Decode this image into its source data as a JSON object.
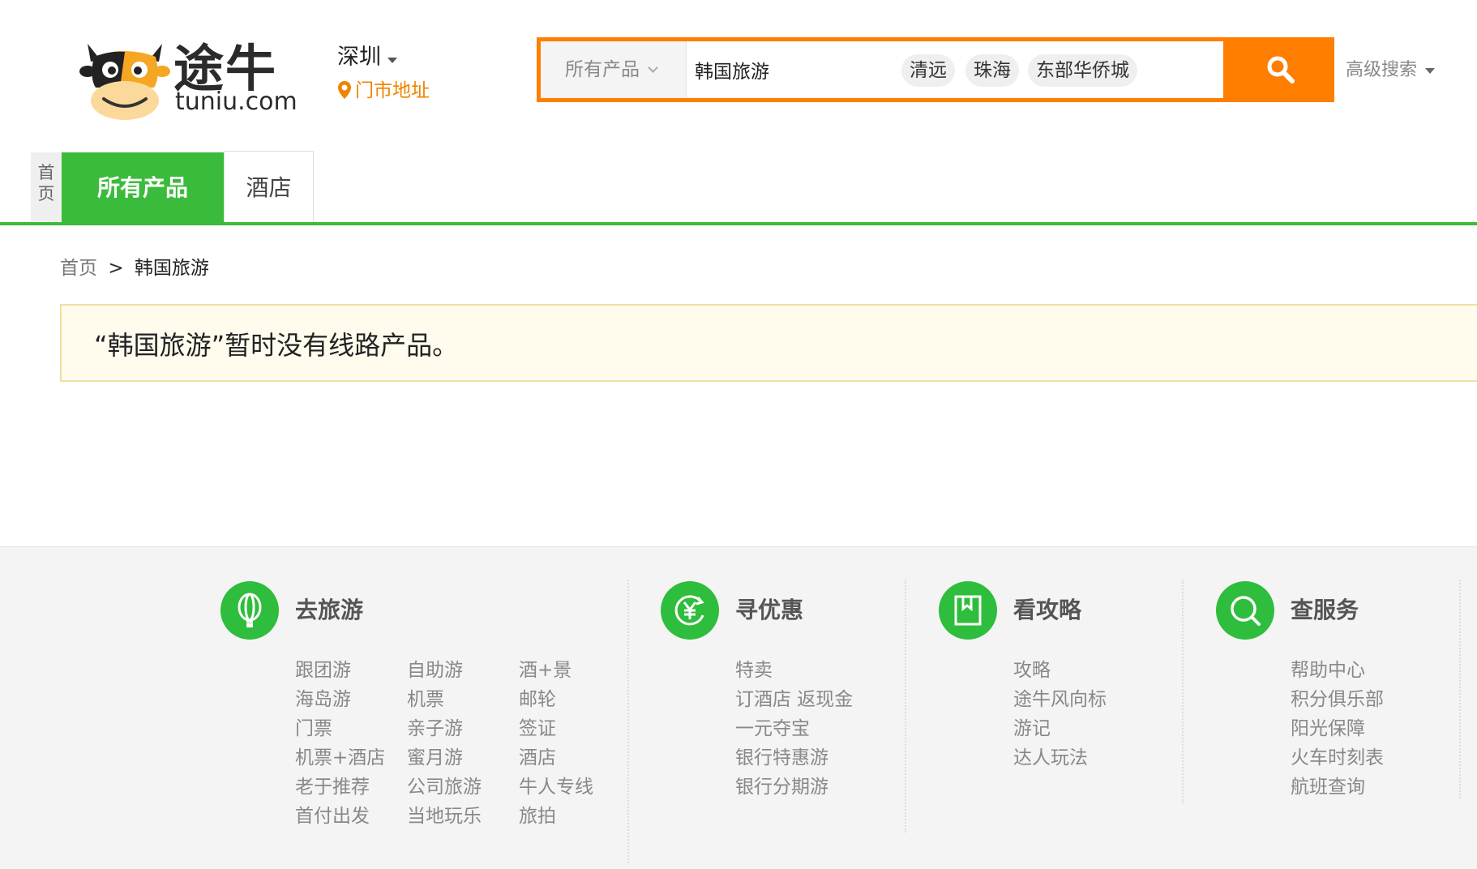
{
  "header": {
    "logo_cn": "途牛",
    "logo_en": "tuniu.com",
    "city": "深圳",
    "store_link": "门市地址",
    "search": {
      "category": "所有产品",
      "query": "韩国旅游",
      "tags": [
        "清远",
        "珠海",
        "东部华侨城"
      ],
      "advanced": "高级搜索"
    }
  },
  "nav": {
    "home": [
      "首",
      "页"
    ],
    "tabs": [
      "所有产品",
      "酒店"
    ]
  },
  "breadcrumb": {
    "home": "首页",
    "separator": ">",
    "current": "韩国旅游"
  },
  "notice": "“韩国旅游”暂时没有线路产品。",
  "footer": {
    "columns": [
      {
        "title": "去旅游",
        "icon": "balloon-icon",
        "links": [
          [
            "跟团游",
            "海岛游",
            "门票",
            "机票+酒店",
            "老于推荐",
            "首付出发"
          ],
          [
            "自助游",
            "机票",
            "亲子游",
            "蜜月游",
            "公司旅游",
            "当地玩乐"
          ],
          [
            "酒+景",
            "邮轮",
            "签证",
            "酒店",
            "牛人专线",
            "旅拍"
          ]
        ]
      },
      {
        "title": "寻优惠",
        "icon": "yen-coin-icon",
        "links": [
          [
            "特卖",
            "订酒店 返现金",
            "一元夺宝",
            "银行特惠游",
            "银行分期游"
          ]
        ]
      },
      {
        "title": "看攻略",
        "icon": "bookmark-icon",
        "links": [
          [
            "攻略",
            "途牛风向标",
            "游记",
            "达人玩法"
          ]
        ]
      },
      {
        "title": "查服务",
        "icon": "search-service-icon",
        "links": [
          [
            "帮助中心",
            "积分俱乐部",
            "阳光保障",
            "火车时刻表",
            "航班查询"
          ]
        ]
      }
    ]
  },
  "colors": {
    "brand_orange": "#ff7e00",
    "brand_green": "#3bbb3b",
    "notice_bg": "#fffcee"
  }
}
